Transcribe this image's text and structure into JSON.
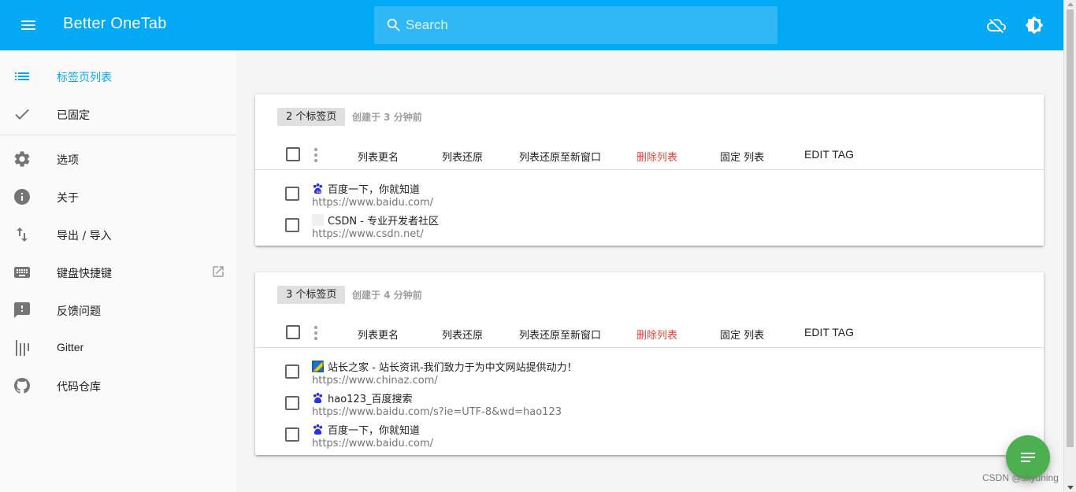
{
  "app": {
    "title": "Better OneTab"
  },
  "search": {
    "placeholder": "Search",
    "value": ""
  },
  "header_icons": [
    "cloud-off-icon",
    "brightness-icon"
  ],
  "sidebar": {
    "items": [
      {
        "label": "标签页列表",
        "icon": "list-icon",
        "active": true
      },
      {
        "label": "已固定",
        "icon": "check-icon"
      },
      {
        "label": "选项",
        "icon": "gear-icon"
      },
      {
        "label": "关于",
        "icon": "info-icon"
      },
      {
        "label": "导出 / 导入",
        "icon": "import-export-icon"
      },
      {
        "label": "键盘快捷键",
        "icon": "keyboard-icon"
      },
      {
        "label": "反馈问题",
        "icon": "feedback-icon"
      },
      {
        "label": "Gitter",
        "icon": "gitter-icon"
      },
      {
        "label": "代码仓库",
        "icon": "github-icon"
      }
    ]
  },
  "toolbar": {
    "rename": "列表更名",
    "restore": "列表还原",
    "restore_new_window": "列表还原至新窗口",
    "delete": "删除列表",
    "pin": "固定 列表",
    "edit_tag": "EDIT TAG"
  },
  "lists": [
    {
      "count_label": "2 个标签页",
      "created": "创建于 3 分钟前",
      "tabs": [
        {
          "title": "百度一下，你就知道",
          "url": "https://www.baidu.com/",
          "favicon": "baidu-favicon"
        },
        {
          "title": "CSDN - 专业开发者社区",
          "url": "https://www.csdn.net/",
          "favicon": "blank-favicon"
        }
      ]
    },
    {
      "count_label": "3 个标签页",
      "created": "创建于 4 分钟前",
      "tabs": [
        {
          "title": "站长之家 - 站长资讯-我们致力于为中文网站提供动力！",
          "url": "https://www.chinaz.com/",
          "favicon": "chinaz-favicon"
        },
        {
          "title": "hao123_百度搜索",
          "url": "https://www.baidu.com/s?ie=UTF-8&wd=hao123",
          "favicon": "baidu-favicon"
        },
        {
          "title": "百度一下，你就知道",
          "url": "https://www.baidu.com/",
          "favicon": "baidu-favicon"
        }
      ]
    }
  ],
  "watermark": "CSDN @skyuning",
  "colors": {
    "primary": "#03a9f4",
    "fab": "#4caf50",
    "danger": "#f44336"
  }
}
